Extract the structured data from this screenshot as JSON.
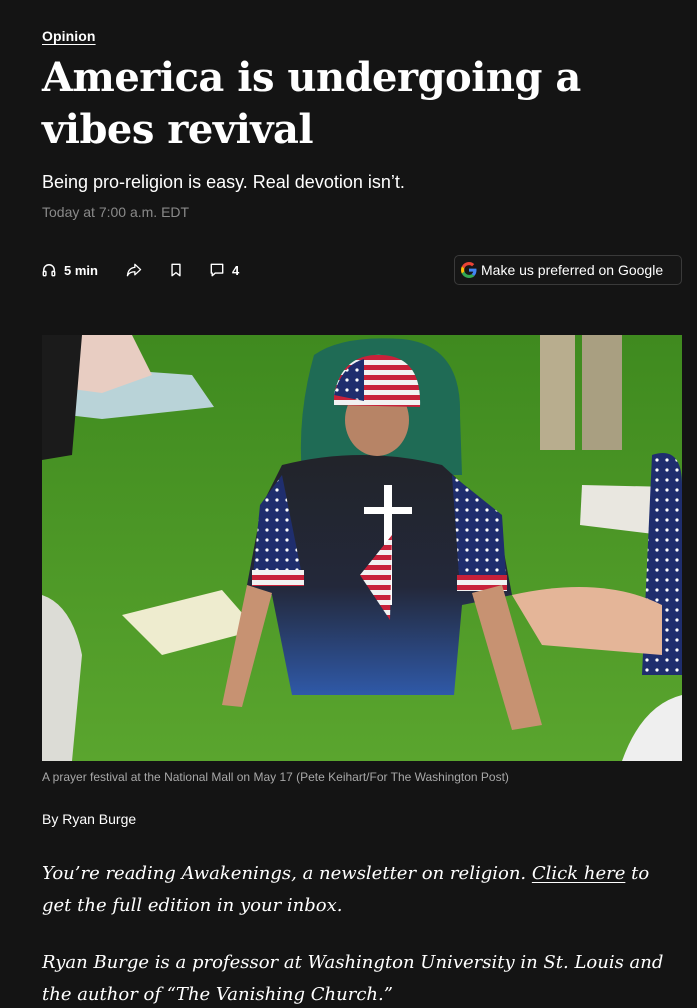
{
  "article": {
    "kicker": "Opinion",
    "headline": "America is undergoing a vibes revival",
    "dek": "Being pro-religion is easy. Real devotion isn’t.",
    "timestamp": "Today at 7:00 a.m. EDT",
    "toolbar": {
      "listen_label": "5 min",
      "comments_count": "4",
      "preferred_label": "Make us preferred on Google"
    },
    "photo_caption": "A prayer festival at the National Mall on May 17 (Pete Keihart/For The Washington Post)",
    "byline_prefix": "By",
    "author": "Ryan Burge",
    "newsletter_note": {
      "before": "You’re reading Awakenings, a newsletter on religion. ",
      "link": "Click here",
      "after": " to get the full edition in your inbox."
    },
    "author_bio": "Ryan Burge is a professor at Washington University in St. Louis and the author of “The Vanishing Church.”"
  },
  "colors": {
    "background": "#141414",
    "text": "#ffffff",
    "muted": "#8a8a8a",
    "grass": "#4f9a2a"
  }
}
